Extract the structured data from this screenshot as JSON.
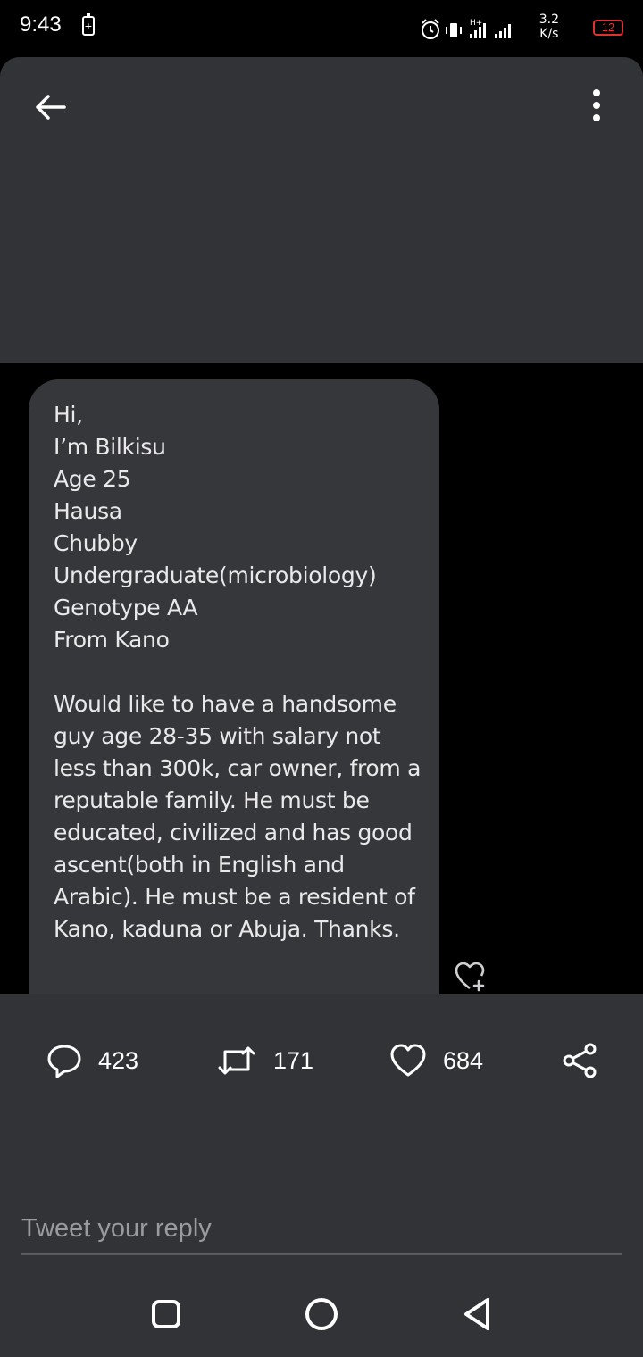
{
  "status_bar": {
    "time": "9:43",
    "battery_saver_glyph": "+",
    "net_speed_value": "3.2",
    "net_speed_unit": "K/s",
    "battery_level": "12",
    "icons": [
      "alarm-icon",
      "vibrate-icon",
      "signal-icon",
      "signal-icon"
    ]
  },
  "header": {
    "back_icon": "arrow-left-icon",
    "menu_icon": "more-vertical-icon"
  },
  "message": {
    "text": "Hi,\nI’m Bilkisu\nAge 25\nHausa\nChubby\nUndergraduate(microbiology)\nGenotype AA\nFrom Kano\n\nWould like to have a handsome guy age 28-35 with salary not less than 300k, car owner, from a reputable family. He must be educated, civilized and has good ascent(both in English and Arabic). He must be a resident of Kano, kaduna or Abuja. Thanks."
  },
  "actions": {
    "replies": "423",
    "retweets": "171",
    "likes": "684"
  },
  "reply": {
    "placeholder": "Tweet your reply"
  },
  "colors": {
    "panel_bg": "#323337",
    "bubble_bg": "#36373b",
    "battery_low": "#e0302f"
  }
}
